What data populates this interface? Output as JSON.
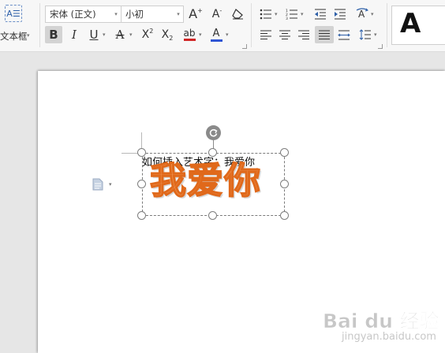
{
  "ribbon": {
    "insert_textbox": {
      "icon": "text-box-icon",
      "icon_text": "A☰",
      "label": "文本框"
    },
    "font_family": "宋体 (正文)",
    "font_size": "小初",
    "buttons": {
      "grow_font": "A",
      "shrink_font": "A",
      "bold": "B",
      "italic": "I",
      "underline": "U",
      "strikethrough": "A",
      "superscript_base": "X",
      "superscript_mark": "2",
      "subscript_base": "X",
      "subscript_mark": "2",
      "highlight": "ab",
      "font_color": "A"
    },
    "style_preview": "A",
    "colors": {
      "highlight_bar": "#d02525",
      "font_color_bar": "#2f55d4",
      "active_button": "#d3d3d3"
    }
  },
  "document": {
    "text_line": "如何插入艺术字：我爱你",
    "wordart": {
      "text": "我爱你",
      "fill": "#f2a264",
      "outline": "#e0691b"
    }
  },
  "watermark": {
    "brand": "Bai du 经验",
    "url": "jingyan.baidu.com"
  }
}
